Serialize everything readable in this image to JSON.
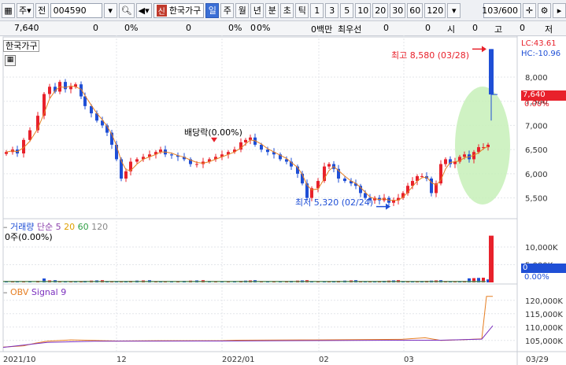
{
  "toolbar": {
    "type_label": "주",
    "jeon_label": "전",
    "code_value": "004590",
    "sin_badge": "신",
    "stock_name": "한국가구",
    "periods": [
      "일",
      "주",
      "월",
      "년",
      "분",
      "초",
      "틱"
    ],
    "selected_period": "일",
    "minutes": [
      "1",
      "3",
      "5",
      "10",
      "20",
      "30",
      "60",
      "120"
    ],
    "count_display": "103/600"
  },
  "infobar": {
    "price": "7,640",
    "change": "0",
    "change_pct": "0%",
    "volume": "0",
    "volume_pct": "0%",
    "volume2": "0",
    "volume2_pct": "0%",
    "amount": "0백만",
    "best_bid_label": "최우선",
    "best_bid": "0",
    "v1": "0",
    "open_label": "시",
    "open_value": "0",
    "high_label": "고",
    "high_value": "0",
    "low_label": "저"
  },
  "price_panel": {
    "title": "한국가구",
    "lc": "LC:43.61",
    "hc": "HC:-10.96",
    "current_price": "7,640",
    "current_pct": "0.00%",
    "high_annotation": "최고 8,580 (03/28)",
    "low_annotation": "최저 5,320 (02/24)",
    "dividend_annotation": "배당락(0.00%)",
    "y_ticks": [
      "8,000",
      "7,500",
      "7,000",
      "6,500",
      "6,000",
      "5,500"
    ]
  },
  "volume_panel": {
    "legend_volume": "거래량",
    "legend_simple": "단순",
    "legend_ma": [
      "5",
      "20",
      "60",
      "120"
    ],
    "value_text": "0주(0.00%)",
    "y_ticks": [
      "10,000K",
      "5,000K"
    ],
    "current_value": "0",
    "current_pct": "0.00%"
  },
  "obv_panel": {
    "legend_obv": "OBV",
    "legend_signal": "Signal 9",
    "y_ticks": [
      "120,000K",
      "115,000K",
      "110,000K",
      "105,000K"
    ]
  },
  "x_axis": [
    "2021/10",
    "12",
    "2022/01",
    "02",
    "03",
    "03/29"
  ],
  "colors": {
    "up": "#e8212b",
    "down": "#1f4fd6",
    "ma5": "#8e44ad",
    "ma20": "#e0a000",
    "ma60": "#2e9e44",
    "obv": "#e67e22",
    "signal": "#7b2fbe",
    "highlight": "#c7f0b8"
  },
  "chart_data": {
    "type": "candlestick",
    "x_labels": [
      "2021/10",
      "12",
      "2022/01",
      "02",
      "03",
      "03/29"
    ],
    "price_high": 8580,
    "price_low": 5320,
    "last_price": 7640,
    "ylim": [
      5200,
      8700
    ]
  }
}
